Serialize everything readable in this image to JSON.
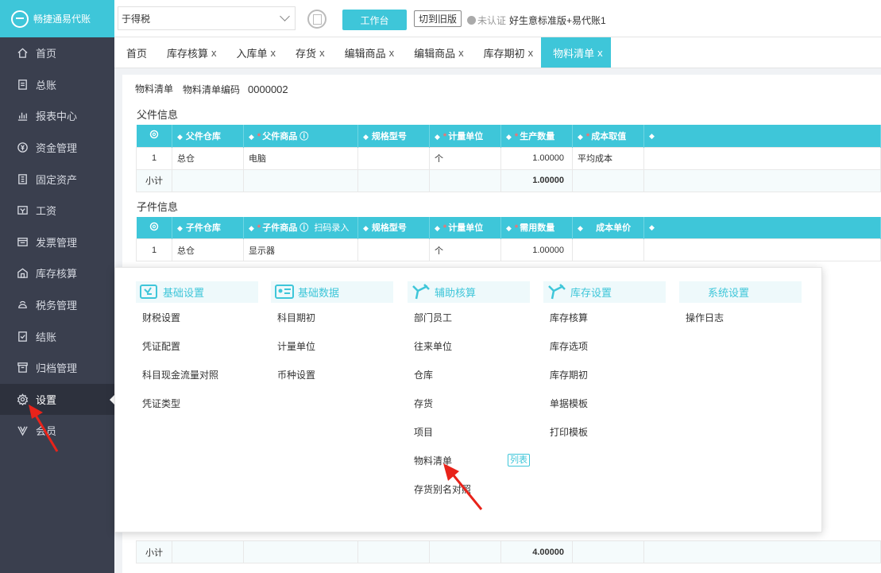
{
  "app": {
    "logo_text": "畅捷通易代账"
  },
  "topbar": {
    "company": "于得税",
    "workbench_label": "工作台",
    "old_version_label": "切到旧版",
    "cert_status": "未认证",
    "product": "好生意标准版+易代账1"
  },
  "sidebar": {
    "items": [
      {
        "label": "首页",
        "icon": "home-icon"
      },
      {
        "label": "总账",
        "icon": "ledger-icon"
      },
      {
        "label": "报表中心",
        "icon": "chart-icon"
      },
      {
        "label": "资金管理",
        "icon": "money-icon"
      },
      {
        "label": "固定资产",
        "icon": "building-icon"
      },
      {
        "label": "工资",
        "icon": "salary-icon"
      },
      {
        "label": "发票管理",
        "icon": "invoice-icon"
      },
      {
        "label": "库存核算",
        "icon": "warehouse-icon"
      },
      {
        "label": "税务管理",
        "icon": "tax-icon"
      },
      {
        "label": "结账",
        "icon": "checkout-icon"
      },
      {
        "label": "归档管理",
        "icon": "archive-icon"
      },
      {
        "label": "设置",
        "icon": "gear-icon"
      },
      {
        "label": "会员",
        "icon": "vip-icon"
      }
    ],
    "active": "设置"
  },
  "tabs": [
    {
      "label": "首页",
      "closable": false
    },
    {
      "label": "库存核算",
      "closable": true
    },
    {
      "label": "入库单",
      "closable": true
    },
    {
      "label": "存货",
      "closable": true
    },
    {
      "label": "编辑商品",
      "closable": true
    },
    {
      "label": "编辑商品",
      "closable": true
    },
    {
      "label": "库存期初",
      "closable": true
    },
    {
      "label": "物料清单",
      "closable": true,
      "active": true
    }
  ],
  "close_glyph": "x",
  "content": {
    "subtab": "物料清单",
    "bom_code_label": "物料清单编码",
    "bom_code_value": "0000002",
    "parent_title": "父件信息",
    "parent_headers": [
      "父件仓库",
      "父件商品",
      "规格型号",
      "计量单位",
      "生产数量",
      "成本取值"
    ],
    "parent_rows": [
      {
        "idx": "1",
        "warehouse": "总仓",
        "product": "电脑",
        "spec": "",
        "unit": "个",
        "qty": "1.00000",
        "cost": "平均成本"
      }
    ],
    "parent_subtotal_label": "小计",
    "parent_subtotal": "1.00000",
    "child_title": "子件信息",
    "child_headers": [
      "子件仓库",
      "子件商品",
      "规格型号",
      "计量单位",
      "需用数量",
      "成本单价"
    ],
    "child_scan_label": "扫码录入",
    "child_rows": [
      {
        "idx": "1",
        "warehouse": "总仓",
        "product": "显示器",
        "spec": "",
        "unit": "个",
        "qty": "1.00000",
        "price": ""
      }
    ],
    "child_subtotal_label": "小计",
    "child_subtotal": "4.00000"
  },
  "megamenu": {
    "columns": [
      {
        "title": "基础设置",
        "icon": "settings-card-icon",
        "items": [
          "财税设置",
          "凭证配置",
          "科目现金流量对照",
          "凭证类型"
        ]
      },
      {
        "title": "基础数据",
        "icon": "id-card-icon",
        "items": [
          "科目期初",
          "计量单位",
          "币种设置"
        ]
      },
      {
        "title": "辅助核算",
        "icon": "wrench-icon",
        "items": [
          "部门员工",
          "往来单位",
          "仓库",
          "存货",
          "项目",
          "物料清单",
          "存货别名对照"
        ]
      },
      {
        "title": "库存设置",
        "icon": "wrench-icon",
        "items": [
          "库存核算",
          "库存选项",
          "库存期初",
          "单据模板",
          "打印模板"
        ]
      },
      {
        "title": "系统设置",
        "icon": "",
        "items": [
          "操作日志"
        ]
      }
    ],
    "list_badge": "列表"
  },
  "colors": {
    "accent": "#3ec6d9",
    "sidebar_bg": "#3a3f4e",
    "annotation": "#e8231a"
  }
}
